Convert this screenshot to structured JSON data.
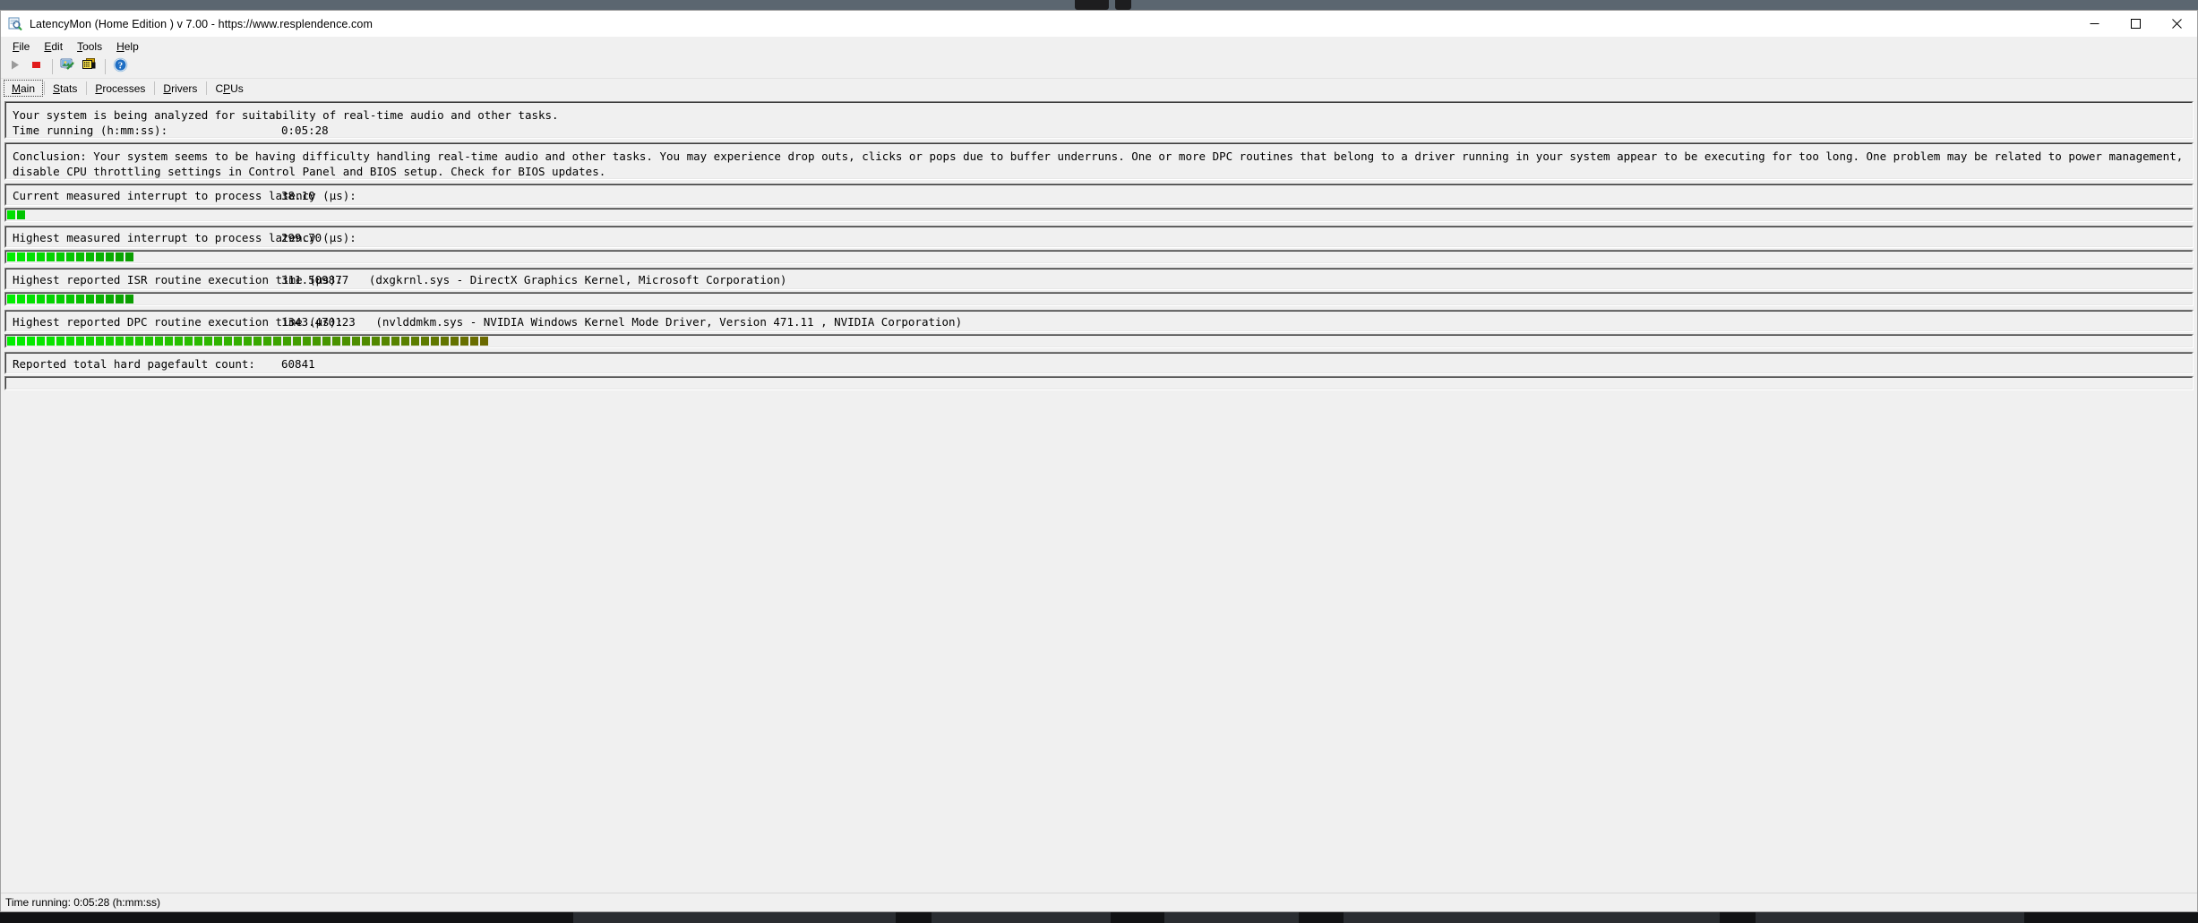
{
  "window": {
    "title": "LatencyMon  (Home Edition )  v 7.00 - https://www.resplendence.com",
    "app_icon": "latencymon-icon",
    "minimize_label": "Minimize",
    "maximize_label": "Maximize",
    "close_label": "Close"
  },
  "menu": {
    "items": [
      {
        "name": "file",
        "pre": "",
        "accel": "F",
        "post": "ile"
      },
      {
        "name": "edit",
        "pre": "",
        "accel": "E",
        "post": "dit"
      },
      {
        "name": "tools",
        "pre": "",
        "accel": "T",
        "post": "ools"
      },
      {
        "name": "help",
        "pre": "",
        "accel": "H",
        "post": "elp"
      }
    ]
  },
  "toolbar": {
    "buttons": [
      {
        "name": "start-monitoring-button",
        "icon": "play-icon",
        "label": "Start monitoring",
        "enabled": false
      },
      {
        "name": "stop-monitoring-button",
        "icon": "stop-icon",
        "label": "Stop monitoring",
        "enabled": true
      },
      {
        "name": "report-button",
        "icon": "monitor-pencil-icon",
        "label": "Create report",
        "enabled": true
      },
      {
        "name": "copy-button",
        "icon": "copy-layers-icon",
        "label": "Copy",
        "enabled": true
      },
      {
        "name": "help-button",
        "icon": "question-mark-icon",
        "label": "Help",
        "enabled": true
      }
    ]
  },
  "tabs": [
    {
      "name": "tab-main",
      "pre": "",
      "accel": "M",
      "post": "ain",
      "active": true
    },
    {
      "name": "tab-stats",
      "pre": "",
      "accel": "S",
      "post": "tats",
      "active": false
    },
    {
      "name": "tab-processes",
      "pre": "",
      "accel": "P",
      "post": "rocesses",
      "active": false
    },
    {
      "name": "tab-drivers",
      "pre": "",
      "accel": "D",
      "post": "rivers",
      "active": false
    },
    {
      "name": "tab-cpus",
      "pre": "C",
      "accel": "P",
      "post": "Us",
      "active": false
    }
  ],
  "main": {
    "analysis_line": "Your system is being analyzed for suitability of real-time audio and other tasks.",
    "time_running_label": "Time running (h:mm:ss):",
    "time_running_value": "0:05:28",
    "conclusion": "Conclusion: Your system seems to be having difficulty handling real-time audio and other tasks. You may experience drop outs, clicks or pops due to buffer underruns. One or more DPC routines that belong to a driver running in your system appear to be executing for too long. One problem may be related to power management, disable CPU throttling settings in Control Panel and BIOS setup. Check for BIOS updates.",
    "metrics": [
      {
        "name": "current-interrupt-to-process-latency",
        "label": "Current measured interrupt to process latency (µs):",
        "value": "38.10",
        "detail": "",
        "bar_segments": 2,
        "bar_start_color": "#00e000",
        "bar_end_color": "#00c400"
      },
      {
        "name": "highest-interrupt-to-process-latency",
        "label": "Highest measured interrupt to process latency (µs):",
        "value": "299.70",
        "detail": "",
        "bar_segments": 13,
        "bar_start_color": "#00ee00",
        "bar_end_color": "#0a9e00"
      },
      {
        "name": "highest-isr-routine-execution-time",
        "label": "Highest reported ISR routine execution time (µs):",
        "value": "311.509877",
        "detail": "(dxgkrnl.sys - DirectX Graphics Kernel, Microsoft Corporation)",
        "bar_segments": 13,
        "bar_start_color": "#00ee00",
        "bar_end_color": "#0a9e00"
      },
      {
        "name": "highest-dpc-routine-execution-time",
        "label": "Highest reported DPC routine execution time (µs):",
        "value": "1343.470123",
        "detail": "(nvlddmkm.sys - NVIDIA Windows Kernel Mode Driver, Version 471.11 , NVIDIA Corporation)",
        "bar_segments": 49,
        "bar_start_color": "#00ee00",
        "bar_end_color": "#6b6a00"
      },
      {
        "name": "reported-total-hard-pagefault-count",
        "label": "Reported total hard pagefault count:",
        "value": "60841",
        "detail": "",
        "bar_segments": 0,
        "bar_start_color": "#00ee00",
        "bar_end_color": "#00ee00"
      }
    ]
  },
  "status_bar": {
    "text": "Time running: 0:05:28  (h:mm:ss)"
  },
  "colors": {
    "window_bg": "#f0f0f0",
    "title_bg": "#ffffff",
    "desktop": "#5b6670",
    "taskbar": "#111214"
  }
}
